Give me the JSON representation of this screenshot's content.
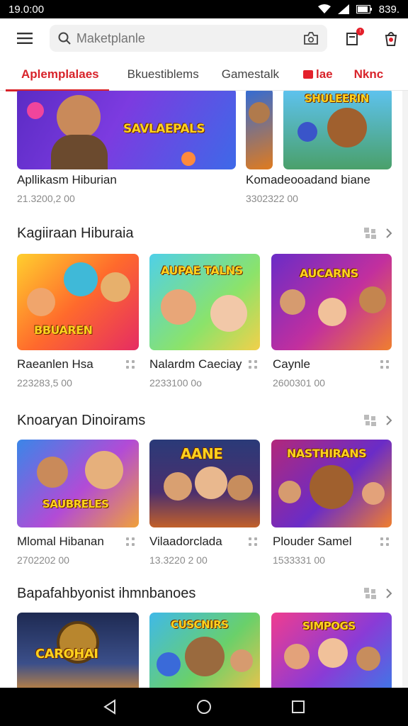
{
  "status_bar": {
    "time": "19.0:00",
    "battery": "839."
  },
  "app_bar": {
    "search_placeholder": "Maketplanle",
    "notif_badge": "!"
  },
  "tabs": [
    {
      "label": "Aplemplalaes",
      "active": true
    },
    {
      "label": "Bkuestiblems",
      "active": false
    },
    {
      "label": "Gamestalk",
      "active": false
    },
    {
      "label": "lae",
      "active": false
    },
    {
      "label": "Nknc",
      "active": false
    }
  ],
  "top_row": [
    {
      "title": "Apllikasm Hiburian",
      "sub": "21.3200,2 00",
      "banner": "SAVLAEPALS"
    },
    {
      "title": "Komadeooadand biane",
      "sub": "3302322 00",
      "banner": "SHULEERIN"
    }
  ],
  "sections": [
    {
      "title": "Kagiiraan Hiburaia",
      "items": [
        {
          "title": "Raeanlen Hsa",
          "sub": "223283,5 00",
          "banner": "BBUAREN"
        },
        {
          "title": "Nalardm Caeciay",
          "sub": "2233100 0o",
          "banner": "AUPAE TALNS"
        },
        {
          "title": "Caynle",
          "sub": "2600301 00",
          "banner": "AUCARNS"
        }
      ]
    },
    {
      "title": "Knoaryan Dinoirams",
      "items": [
        {
          "title": "Mlomal Hibanan",
          "sub": "2702202 00",
          "banner": "SAUBRELES"
        },
        {
          "title": "Vilaadorclada",
          "sub": "13.3220 2 00",
          "banner": "AANE"
        },
        {
          "title": "Plouder Samel",
          "sub": "1533331 00",
          "banner": "NASTHIRANS"
        }
      ]
    },
    {
      "title": "Bapafahbyonist ihmnbanoes",
      "items": [
        {
          "title": "",
          "sub": "",
          "banner": "CAROHAI"
        },
        {
          "title": "",
          "sub": "",
          "banner": "CUSCNIRS"
        },
        {
          "title": "",
          "sub": "",
          "banner": "SIMPOGS"
        }
      ]
    }
  ],
  "colors": {
    "accent": "#d8232a",
    "text": "#222222",
    "subtext": "#8a8a8a"
  }
}
